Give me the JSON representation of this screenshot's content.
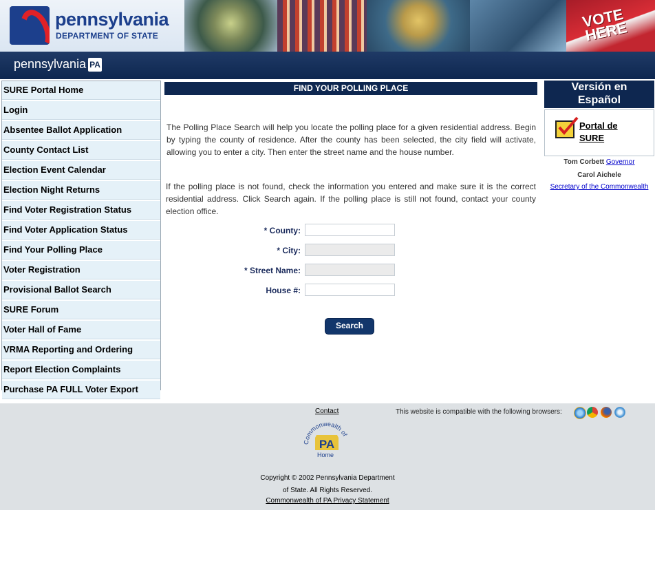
{
  "header": {
    "logo_title": "pennsylvania",
    "logo_subtitle": "DEPARTMENT OF STATE",
    "banner_sign": "VOTE HERE",
    "nav_brand": "pennsylvania",
    "nav_badge": "PA"
  },
  "sidebar": {
    "items": [
      {
        "label": "SURE Portal Home"
      },
      {
        "label": "Login"
      },
      {
        "label": "Absentee Ballot Application"
      },
      {
        "label": "County Contact List"
      },
      {
        "label": "Election Event Calendar"
      },
      {
        "label": "Election Night Returns"
      },
      {
        "label": "Find Voter Registration Status"
      },
      {
        "label": "Find Voter Application Status"
      },
      {
        "label": "Find Your Polling Place"
      },
      {
        "label": "Voter Registration"
      },
      {
        "label": "Provisional Ballot Search"
      },
      {
        "label": "SURE Forum"
      },
      {
        "label": "Voter Hall of Fame"
      },
      {
        "label": "VRMA Reporting and Ordering"
      },
      {
        "label": "Report Election Complaints"
      },
      {
        "label": "Purchase PA FULL Voter Export"
      }
    ]
  },
  "main": {
    "title": "FIND YOUR POLLING PLACE",
    "intro": "The Polling Place Search will help you locate the polling place for a given residential address. Begin by typing the county of residence. After the county has been selected, the city field will activate, allowing you to enter a city. Then enter the street name and the house number.",
    "note": "If the polling place is not found, check the information you entered and make sure it is the correct residential address. Click Search again. If the polling place is still not found, contact your county election office.",
    "form": {
      "county_label": "* County:",
      "county_value": "",
      "city_label": "* City:",
      "city_value": "",
      "street_label": "* Street Name:",
      "street_value": "",
      "house_label": "House #:",
      "house_value": ""
    },
    "search_button": "Search"
  },
  "right": {
    "spanish_line1": "Versión en",
    "spanish_line2": "Español",
    "portal_line1": "Portal de",
    "portal_line2": "SURE",
    "governor_name": "Tom Corbett",
    "governor_link": "Governor",
    "secretary_name": "Carol Aichele",
    "secretary_link": "Secretary of the Commonwealth"
  },
  "footer": {
    "contact": "Contact",
    "seal_text": "Commonwealth of",
    "seal_pa": "PA",
    "seal_home": "Home",
    "compat": "This website is compatible with the following browsers:",
    "browsers": [
      "ie-icon",
      "chrome-icon",
      "firefox-icon",
      "safari-icon"
    ],
    "copyright_line1": "Copyright © 2002 Pennsylvania Department",
    "copyright_line2": "of State. All Rights Reserved.",
    "privacy": "Commonwealth of PA Privacy Statement"
  },
  "colors": {
    "navy": "#0e2750",
    "sidebar_bg": "#e5f1f8",
    "footer_bg": "#dde1e4",
    "label_blue": "#1b2b5c"
  }
}
